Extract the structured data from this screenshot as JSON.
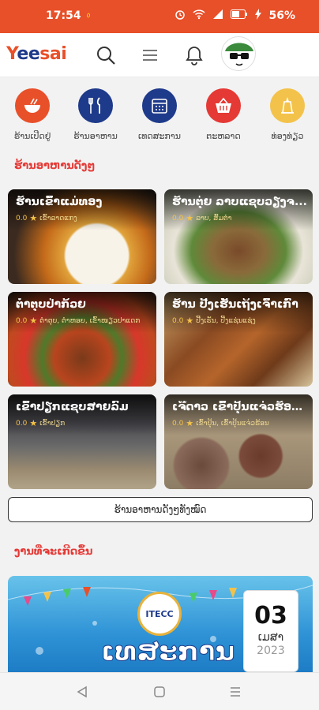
{
  "status_bar": {
    "time": "17:54",
    "tick": "᥆",
    "battery": "56%"
  },
  "brand": {
    "logo_y": "Y",
    "logo_ee": "ee",
    "logo_sai": "sai"
  },
  "colors": {
    "accent": "#e8502a",
    "navy": "#1e3a8a",
    "red": "#e53935",
    "yellow": "#f3c24a"
  },
  "header_icons": [
    "search-icon",
    "menu-icon",
    "bell-icon",
    "avatar"
  ],
  "categories": [
    {
      "label": "ຮ້ານເປີດຢູ່",
      "icon": "bowl-icon",
      "color": "#e8502a"
    },
    {
      "label": "ຮ້ານອາຫານ",
      "icon": "fork-knife-icon",
      "color": "#1e3a8a"
    },
    {
      "label": "ເທດສະການ",
      "icon": "calendar-icon",
      "color": "#1e3a8a"
    },
    {
      "label": "ຕະຫລາດ",
      "icon": "basket-icon",
      "color": "#e53935"
    },
    {
      "label": "ທ່ອງທ່ຽວ",
      "icon": "temple-icon",
      "color": "#f3c24a"
    }
  ],
  "popular": {
    "title": "ຮ້ານອາຫານດັງໆ",
    "see_all": "ຮ້ານອາຫານດັງໆທັງໝົດ",
    "restaurants": [
      {
        "name": "ຮ້ານເຂົ້າແມ່ທອງ",
        "rating": "0.0",
        "area": "ເຂົ້າລາດແກງ"
      },
      {
        "name": "ຮ້ານຕຸ່ຍ ລາບແຊບວຽງຈ...",
        "rating": "0.0",
        "area": "ລາບ, ສົ້ມຕໍາ"
      },
      {
        "name": "ຕໍາຕຸບປ່າກ້ວຍ",
        "rating": "0.0",
        "area": "ຕໍາຕຸບ, ຕໍາຫອຍ, ເຂົ້າໜຽວປາແດກ"
      },
      {
        "name": "ຮ້ານ ປີ້ງເຮັນເຖິງເຈົ້າເກົ່າ",
        "rating": "0.0",
        "area": "ປີ້ງເຮັນ, ປີ້ງແຊ່ນແຊ່ງ"
      },
      {
        "name": "ເຂົ້າປຽກແຊບສາຍລົມ",
        "rating": "0.0",
        "area": "ເຂົ້າປຽກ"
      },
      {
        "name": "ເຈ໊ດາວ ເຂົ້າປຸ້ນແຈ່ວຮ້ອງວ...",
        "rating": "0.0",
        "area": "ເຂົ້າປຸ້ນ, ເຂົ້າປຸ້ນແຈ່ວຮ້ອນ"
      }
    ]
  },
  "events": {
    "title": "ງານທີ່ຈະເກີດຂຶ້ນ",
    "banner_org": "ITECC",
    "banner_text": "ເທສະການ",
    "date_day": "03",
    "date_month": "ເມສາ",
    "date_year": "2023"
  },
  "nav": [
    "back-icon",
    "home-icon",
    "recents-icon"
  ]
}
